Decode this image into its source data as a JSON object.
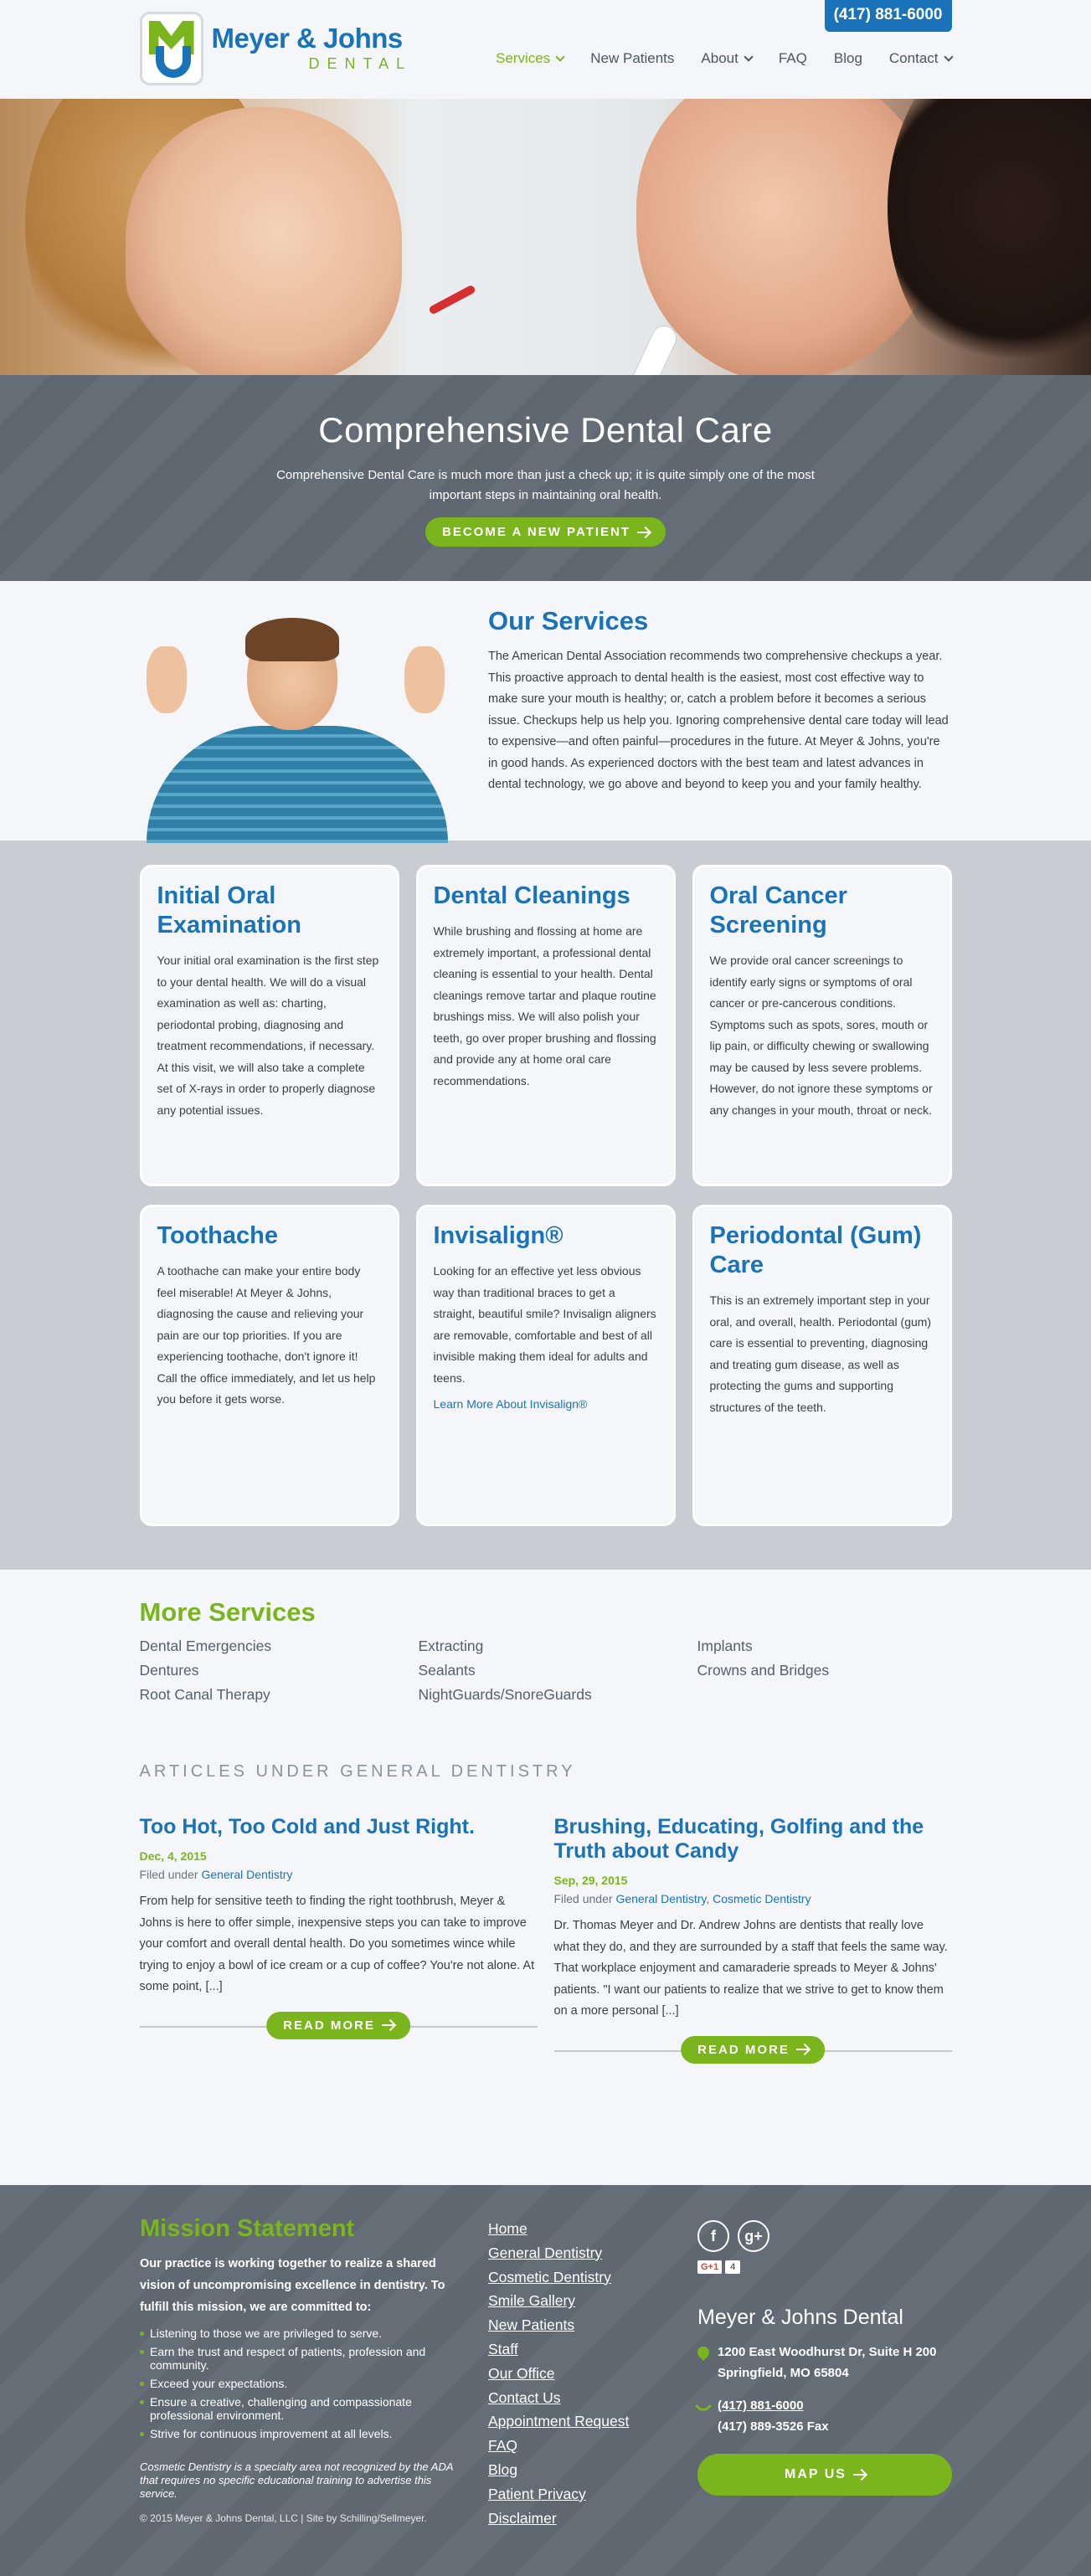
{
  "header": {
    "logo_name": "Meyer & Johns",
    "logo_sub": "DENTAL",
    "phone": "(417) 881-6000",
    "nav": [
      {
        "label": "Services",
        "dropdown": true
      },
      {
        "label": "New Patients",
        "dropdown": false
      },
      {
        "label": "About",
        "dropdown": true
      },
      {
        "label": "FAQ",
        "dropdown": false
      },
      {
        "label": "Blog",
        "dropdown": false
      },
      {
        "label": "Contact",
        "dropdown": true
      }
    ]
  },
  "cta": {
    "title": "Comprehensive Dental Care",
    "text": "Comprehensive Dental Care is much more than just a check up; it is quite simply one of the most important steps in maintaining oral health.",
    "button": "BECOME A NEW PATIENT"
  },
  "our_services": {
    "title": "Our Services",
    "text": "The American Dental Association recommends two comprehensive checkups a year. This proactive approach to dental health is the easiest, most cost effective way to make sure your mouth is healthy; or, catch a problem before it becomes a serious issue. Checkups help us help you. Ignoring comprehensive dental care today will lead to expensive—and often painful—procedures in the future. At Meyer & Johns, you're in good hands. As experienced doctors with the best team and latest advances in dental technology, we go above and beyond to keep you and your family healthy."
  },
  "cards": [
    {
      "title": "Initial Oral Examination",
      "text": "Your initial oral examination is the first step to your dental health. We will do a visual examination as well as: charting, periodontal probing, diagnosing and treatment recommendations, if necessary. At this visit, we will also take a complete set of X-rays in order to properly diagnose any potential issues."
    },
    {
      "title": "Dental Cleanings",
      "text": "While brushing and flossing at home are extremely important, a professional dental cleaning is essential to your health. Dental cleanings remove tartar and plaque routine brushings miss. We will also polish your teeth, go over proper brushing and flossing and provide any at home oral care recommendations."
    },
    {
      "title": "Oral Cancer Screening",
      "text": "We provide oral cancer screenings to identify early signs or symptoms of oral cancer or pre-cancerous conditions. Symptoms such as spots, sores, mouth or lip pain, or difficulty chewing or swallowing may be caused by less severe problems. However, do not ignore these symptoms or any changes in your mouth, throat or neck."
    },
    {
      "title": "Toothache",
      "text": "A toothache can make your entire body feel miserable! At Meyer & Johns, diagnosing the cause and relieving your pain are our top priorities. If you are experiencing toothache, don't ignore it! Call the office immediately, and let us help you before it gets worse."
    },
    {
      "title": "Invisalign®",
      "text": "Looking for an effective yet less obvious way than traditional braces to get a straight, beautiful smile? Invisalign aligners are removable, comfortable and best of all invisible making them ideal for adults and teens.",
      "link": "Learn More About Invisalign®"
    },
    {
      "title": "Periodontal (Gum) Care",
      "text": "This is an extremely important step in your oral, and overall, health. Periodontal (gum) care is essential to preventing, diagnosing and treating gum disease, as well as protecting the gums and supporting structures of the teeth."
    }
  ],
  "more": {
    "title": "More Services",
    "items": [
      "Dental Emergencies",
      "Extracting",
      "Implants",
      "Dentures",
      "Sealants",
      "Crowns and Bridges",
      "Root Canal Therapy",
      "NightGuards/SnoreGuards"
    ]
  },
  "articles_heading": "ARTICLES UNDER GENERAL DENTISTRY",
  "articles": [
    {
      "title": "Too Hot, Too Cold and Just Right.",
      "date": "Dec, 4, 2015",
      "filed_prefix": "Filed under",
      "categories": [
        "General Dentistry"
      ],
      "excerpt": "From help for sensitive teeth to finding the right toothbrush, Meyer & Johns is here to offer simple, inexpensive steps you can take to improve your comfort and overall dental health. Do you sometimes wince while trying to enjoy a bowl of ice cream or a cup of coffee? You're not alone. At some point, [...]",
      "button": "READ MORE"
    },
    {
      "title": "Brushing, Educating, Golfing and the Truth about Candy",
      "date": "Sep, 29, 2015",
      "filed_prefix": "Filed under",
      "categories": [
        "General Dentistry",
        "Cosmetic Dentistry"
      ],
      "excerpt": "Dr. Thomas Meyer and Dr. Andrew Johns are dentists that really love what they do, and they are surrounded by a staff that feels the same way. That workplace enjoyment and camaraderie spreads to Meyer & Johns' patients. \"I want our patients to realize that we strive to get to know them on a more personal [...]",
      "button": "READ MORE"
    }
  ],
  "footer": {
    "mission_title": "Mission Statement",
    "mission_lead": "Our practice is working together to realize a shared vision of uncompromising excellence in dentistry. To fulfill this mission, we are committed to:",
    "bullets": [
      "Listening to those we are privileged to serve.",
      "Earn the trust and respect of patients, profession and community.",
      "Exceed your expectations.",
      "Ensure a creative, challenging and compassionate professional environment.",
      "Strive for continuous improvement at all levels."
    ],
    "disclaimer": "Cosmetic Dentistry is a specialty area not recognized by the ADA that requires no specific educational training to advertise this service.",
    "copyright": "© 2015 Meyer & Johns Dental, LLC | Site by Schilling/Sellmeyer.",
    "links": [
      "Home",
      "General Dentistry",
      "Cosmetic Dentistry",
      "Smile Gallery",
      "New Patients",
      "Staff",
      "Our Office",
      "Contact Us",
      "Appointment Request",
      "FAQ",
      "Blog",
      "Patient Privacy",
      "Disclaimer"
    ],
    "social": {
      "facebook": "f",
      "gplus": "g+",
      "gplus_badge": "G+1",
      "gplus_count": "4"
    },
    "practice": "Meyer & Johns Dental",
    "address1": "1200 East Woodhurst Dr, Suite H 200",
    "address2": "Springfield, MO 65804",
    "phone": "(417) 881-6000",
    "fax": "(417) 889-3526 Fax",
    "map_button": "MAP US"
  },
  "colors": {
    "blue": "#1a73b8",
    "green": "#7ab51d",
    "slate": "#5f6870"
  }
}
